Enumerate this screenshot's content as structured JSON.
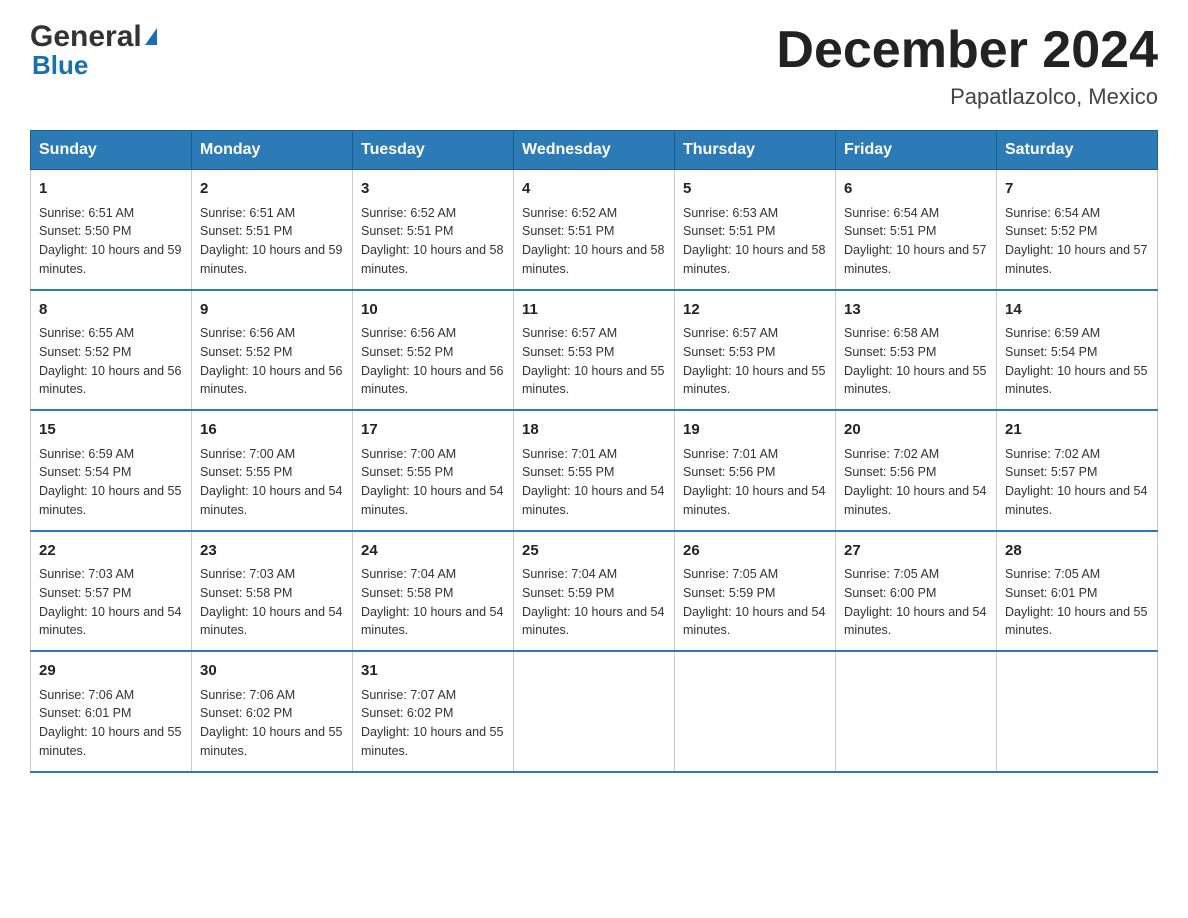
{
  "logo": {
    "general": "General",
    "triangle": "▶",
    "blue": "Blue"
  },
  "title": "December 2024",
  "subtitle": "Papatlazolco, Mexico",
  "weekdays": [
    "Sunday",
    "Monday",
    "Tuesday",
    "Wednesday",
    "Thursday",
    "Friday",
    "Saturday"
  ],
  "weeks": [
    [
      {
        "day": "1",
        "sunrise": "6:51 AM",
        "sunset": "5:50 PM",
        "daylight": "10 hours and 59 minutes."
      },
      {
        "day": "2",
        "sunrise": "6:51 AM",
        "sunset": "5:51 PM",
        "daylight": "10 hours and 59 minutes."
      },
      {
        "day": "3",
        "sunrise": "6:52 AM",
        "sunset": "5:51 PM",
        "daylight": "10 hours and 58 minutes."
      },
      {
        "day": "4",
        "sunrise": "6:52 AM",
        "sunset": "5:51 PM",
        "daylight": "10 hours and 58 minutes."
      },
      {
        "day": "5",
        "sunrise": "6:53 AM",
        "sunset": "5:51 PM",
        "daylight": "10 hours and 58 minutes."
      },
      {
        "day": "6",
        "sunrise": "6:54 AM",
        "sunset": "5:51 PM",
        "daylight": "10 hours and 57 minutes."
      },
      {
        "day": "7",
        "sunrise": "6:54 AM",
        "sunset": "5:52 PM",
        "daylight": "10 hours and 57 minutes."
      }
    ],
    [
      {
        "day": "8",
        "sunrise": "6:55 AM",
        "sunset": "5:52 PM",
        "daylight": "10 hours and 56 minutes."
      },
      {
        "day": "9",
        "sunrise": "6:56 AM",
        "sunset": "5:52 PM",
        "daylight": "10 hours and 56 minutes."
      },
      {
        "day": "10",
        "sunrise": "6:56 AM",
        "sunset": "5:52 PM",
        "daylight": "10 hours and 56 minutes."
      },
      {
        "day": "11",
        "sunrise": "6:57 AM",
        "sunset": "5:53 PM",
        "daylight": "10 hours and 55 minutes."
      },
      {
        "day": "12",
        "sunrise": "6:57 AM",
        "sunset": "5:53 PM",
        "daylight": "10 hours and 55 minutes."
      },
      {
        "day": "13",
        "sunrise": "6:58 AM",
        "sunset": "5:53 PM",
        "daylight": "10 hours and 55 minutes."
      },
      {
        "day": "14",
        "sunrise": "6:59 AM",
        "sunset": "5:54 PM",
        "daylight": "10 hours and 55 minutes."
      }
    ],
    [
      {
        "day": "15",
        "sunrise": "6:59 AM",
        "sunset": "5:54 PM",
        "daylight": "10 hours and 55 minutes."
      },
      {
        "day": "16",
        "sunrise": "7:00 AM",
        "sunset": "5:55 PM",
        "daylight": "10 hours and 54 minutes."
      },
      {
        "day": "17",
        "sunrise": "7:00 AM",
        "sunset": "5:55 PM",
        "daylight": "10 hours and 54 minutes."
      },
      {
        "day": "18",
        "sunrise": "7:01 AM",
        "sunset": "5:55 PM",
        "daylight": "10 hours and 54 minutes."
      },
      {
        "day": "19",
        "sunrise": "7:01 AM",
        "sunset": "5:56 PM",
        "daylight": "10 hours and 54 minutes."
      },
      {
        "day": "20",
        "sunrise": "7:02 AM",
        "sunset": "5:56 PM",
        "daylight": "10 hours and 54 minutes."
      },
      {
        "day": "21",
        "sunrise": "7:02 AM",
        "sunset": "5:57 PM",
        "daylight": "10 hours and 54 minutes."
      }
    ],
    [
      {
        "day": "22",
        "sunrise": "7:03 AM",
        "sunset": "5:57 PM",
        "daylight": "10 hours and 54 minutes."
      },
      {
        "day": "23",
        "sunrise": "7:03 AM",
        "sunset": "5:58 PM",
        "daylight": "10 hours and 54 minutes."
      },
      {
        "day": "24",
        "sunrise": "7:04 AM",
        "sunset": "5:58 PM",
        "daylight": "10 hours and 54 minutes."
      },
      {
        "day": "25",
        "sunrise": "7:04 AM",
        "sunset": "5:59 PM",
        "daylight": "10 hours and 54 minutes."
      },
      {
        "day": "26",
        "sunrise": "7:05 AM",
        "sunset": "5:59 PM",
        "daylight": "10 hours and 54 minutes."
      },
      {
        "day": "27",
        "sunrise": "7:05 AM",
        "sunset": "6:00 PM",
        "daylight": "10 hours and 54 minutes."
      },
      {
        "day": "28",
        "sunrise": "7:05 AM",
        "sunset": "6:01 PM",
        "daylight": "10 hours and 55 minutes."
      }
    ],
    [
      {
        "day": "29",
        "sunrise": "7:06 AM",
        "sunset": "6:01 PM",
        "daylight": "10 hours and 55 minutes."
      },
      {
        "day": "30",
        "sunrise": "7:06 AM",
        "sunset": "6:02 PM",
        "daylight": "10 hours and 55 minutes."
      },
      {
        "day": "31",
        "sunrise": "7:07 AM",
        "sunset": "6:02 PM",
        "daylight": "10 hours and 55 minutes."
      },
      null,
      null,
      null,
      null
    ]
  ]
}
